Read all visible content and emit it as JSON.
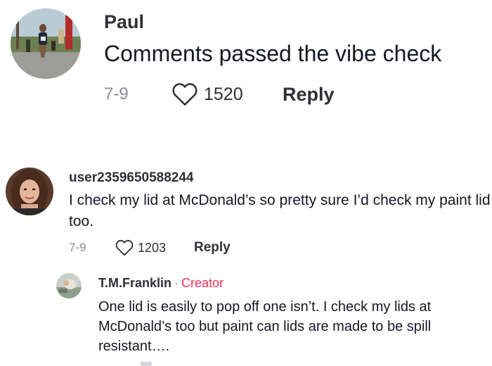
{
  "colors": {
    "text": "#161823",
    "username": "#2f2f35",
    "muted": "#8a8b91",
    "creator_badge": "#fe2c55",
    "background": "#ffffff"
  },
  "comments": [
    {
      "username": "Paul",
      "text": "Comments passed the vibe check",
      "date": "7-9",
      "likes": "1520",
      "reply_label": "Reply",
      "like_icon": "heart-outline-icon"
    },
    {
      "username": "user2359650588244",
      "text": "I check my lid at McDonald’s so pretty sure I’d check my paint lid too.",
      "date": "7-9",
      "likes": "1203",
      "reply_label": "Reply",
      "like_icon": "heart-outline-icon",
      "replies": [
        {
          "username": "T.M.Franklin",
          "separator": "·",
          "badge": "Creator",
          "text": "One lid is easily to pop off one isn’t. I check my lids at McDonald’s too but paint can lids are made to be spill resistant…."
        }
      ]
    }
  ]
}
